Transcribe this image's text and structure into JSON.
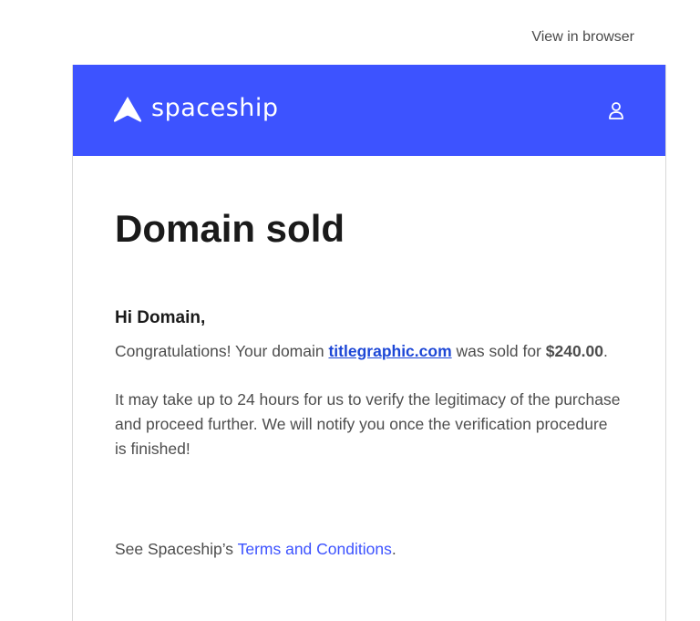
{
  "top": {
    "view_in_browser": "View in browser"
  },
  "header": {
    "brand": "spaceship",
    "brand_color": "#3d53ff",
    "logo_icon": "rocket-triangle-icon",
    "user_icon": "user-icon"
  },
  "email": {
    "title": "Domain sold",
    "greeting": "Hi Domain,",
    "congrats_prefix": "Congratulations! Your domain ",
    "domain": "titlegraphic.com",
    "congrats_middle": " was sold for ",
    "price": "$240.00",
    "congrats_suffix": ".",
    "verification_text": "It may take up to 24 hours for us to verify the legitimacy of the purchase and proceed further. We will notify you once the verification procedure is finished!",
    "terms_prefix": "See Spaceship’s ",
    "terms_link": "Terms and Conditions",
    "terms_suffix": "."
  }
}
